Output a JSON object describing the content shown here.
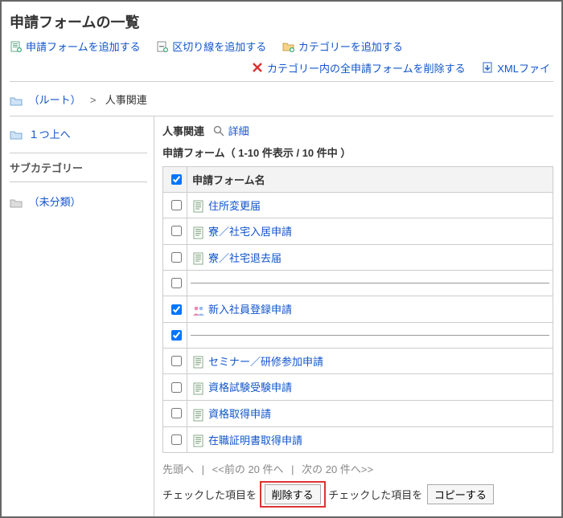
{
  "page_title": "申請フォームの一覧",
  "top_actions": {
    "add_form": "申請フォームを追加する",
    "add_separator": "区切り線を追加する",
    "add_category": "カテゴリーを追加する",
    "delete_all": "カテゴリー内の全申請フォームを削除する",
    "xml_file": "XMLファイ"
  },
  "breadcrumb": {
    "root": "（ルート）",
    "current": "人事関連"
  },
  "sidebar": {
    "up_one": "１つ上へ",
    "subcat_header": "サブカテゴリー",
    "uncategorized": "（未分類）"
  },
  "main": {
    "category_title": "人事関連",
    "detail": "詳細",
    "list_heading": "申請フォーム（ 1-10 件表示 / 10 件中 ）",
    "col_name": "申請フォーム名"
  },
  "forms": [
    {
      "type": "form",
      "name": "住所変更届",
      "checked": false,
      "icon": "form"
    },
    {
      "type": "form",
      "name": "寮／社宅入居申請",
      "checked": false,
      "icon": "form"
    },
    {
      "type": "form",
      "name": "寮／社宅退去届",
      "checked": false,
      "icon": "form"
    },
    {
      "type": "separator"
    },
    {
      "type": "form",
      "name": "新入社員登録申請",
      "checked": true,
      "icon": "people"
    },
    {
      "type": "separator-checked"
    },
    {
      "type": "form",
      "name": "セミナー／研修参加申請",
      "checked": false,
      "icon": "form"
    },
    {
      "type": "form",
      "name": "資格試験受験申請",
      "checked": false,
      "icon": "form"
    },
    {
      "type": "form",
      "name": "資格取得申請",
      "checked": false,
      "icon": "form"
    },
    {
      "type": "form",
      "name": "在職証明書取得申請",
      "checked": false,
      "icon": "form"
    }
  ],
  "pager": {
    "first": "先頭へ",
    "prev": "<<前の 20 件へ",
    "next": "次の 20 件へ>>"
  },
  "bottom": {
    "label": "チェックした項目を",
    "delete": "削除する",
    "copy": "コピーする"
  }
}
